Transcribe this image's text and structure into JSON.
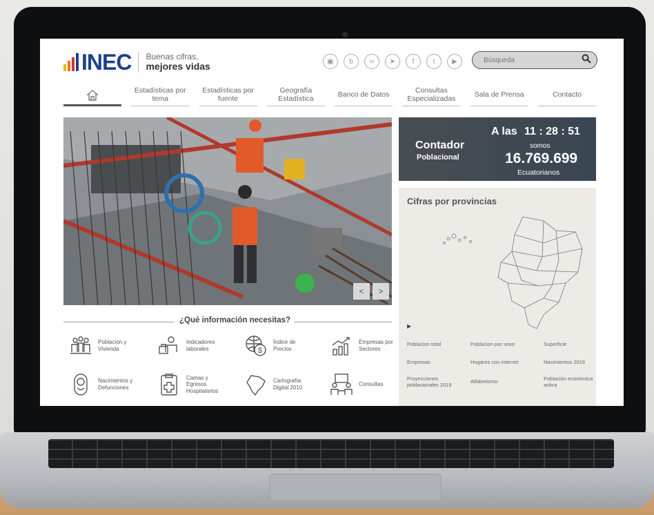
{
  "header": {
    "logo_text": "INEC",
    "tagline_line1": "Buenas cifras,",
    "tagline_line2": "mejores vidas",
    "search_placeholder": "Búsqueda"
  },
  "social_icons": [
    "instagram-icon",
    "blog-icon",
    "flickr-icon",
    "telegram-icon",
    "facebook-icon",
    "twitter-icon",
    "youtube-icon"
  ],
  "nav": [
    {
      "label": ""
    },
    {
      "label": "Estadísticas por tema"
    },
    {
      "label": "Estadísticas por fuente"
    },
    {
      "label": "Geografía Estadística"
    },
    {
      "label": "Banco de Datos"
    },
    {
      "label": "Consultas Especializadas"
    },
    {
      "label": "Sala de Prensa"
    },
    {
      "label": "Contacto"
    }
  ],
  "slider": {
    "prev": "<",
    "next": ">"
  },
  "counter": {
    "title_line1": "Contador",
    "title_line2": "Poblacional",
    "time_prefix": "A las",
    "time": "11 : 28 : 51",
    "somos": "somos",
    "population": "16.769.699",
    "unit": "Ecuatorianos"
  },
  "provincias": {
    "title": "Cifras por provincias",
    "links": [
      "Poblacion total",
      "Poblacion por sexo",
      "Superficie",
      "Empresas",
      "Hogares con internet",
      "Nacimientos 2016",
      "Proyecciones poblacionales 2018",
      "Alfabetismo",
      "Población económica activa"
    ]
  },
  "info": {
    "title": "¿Qué información necesitas?",
    "items": [
      {
        "label": "Población y Vivienda"
      },
      {
        "label": "Indicadores laborales"
      },
      {
        "label": "Índice de Precios"
      },
      {
        "label": "Empresas por Sectores"
      },
      {
        "label": "Nacimientos y Defunciones"
      },
      {
        "label": "Camas y Egresos Hospitalarios"
      },
      {
        "label": "Cartografía Digital 2010"
      },
      {
        "label": "Consultas"
      }
    ]
  },
  "colors": {
    "brand_blue": "#1d3f8f",
    "bar_yellow": "#f2b51b",
    "bar_orange": "#e8761f",
    "bar_red": "#d43a2d",
    "counter_bg": "#3d4955"
  }
}
